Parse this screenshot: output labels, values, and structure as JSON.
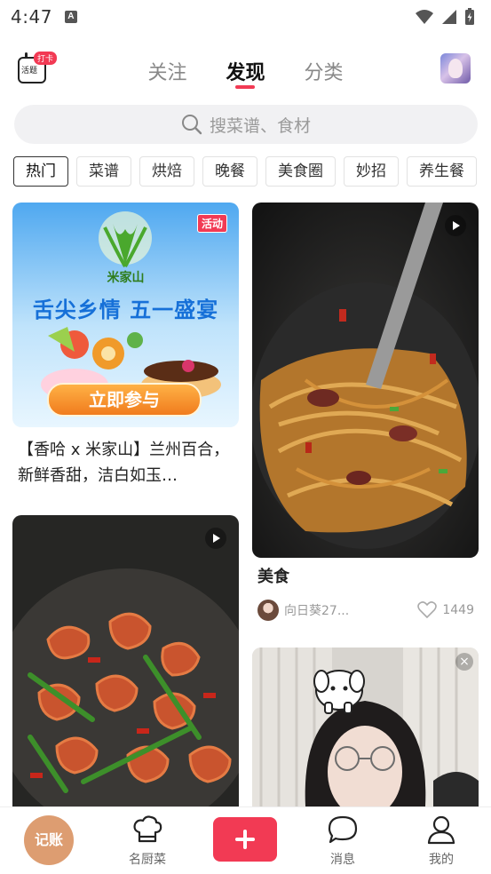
{
  "status_bar": {
    "time": "4:47",
    "a_badge": "A"
  },
  "header": {
    "checkin_badge": "打卡",
    "checkin_label": "活题",
    "tabs": [
      {
        "label": "关注",
        "active": false
      },
      {
        "label": "发现",
        "active": true
      },
      {
        "label": "分类",
        "active": false
      }
    ]
  },
  "search": {
    "placeholder": "搜菜谱、食材"
  },
  "categories": [
    "热门",
    "菜谱",
    "烘焙",
    "晚餐",
    "美食圈",
    "妙招",
    "养生餐"
  ],
  "feed": {
    "card1": {
      "badge": "活动",
      "brand": "米家山",
      "slogan": "舌尖乡情 五一盛宴",
      "cta": "立即参与",
      "title": "【香哈 x 米家山】兰州百合，新鲜香甜，洁白如玉…"
    },
    "card2": {
      "title": "美食",
      "author": "向日葵27...",
      "likes": "1449"
    }
  },
  "bottom_nav": {
    "jizhang": "记账",
    "chef": "名厨菜",
    "messages": "消息",
    "mine": "我的"
  },
  "colors": {
    "accent": "#f23a54",
    "jizhang": "#dd9d71"
  }
}
